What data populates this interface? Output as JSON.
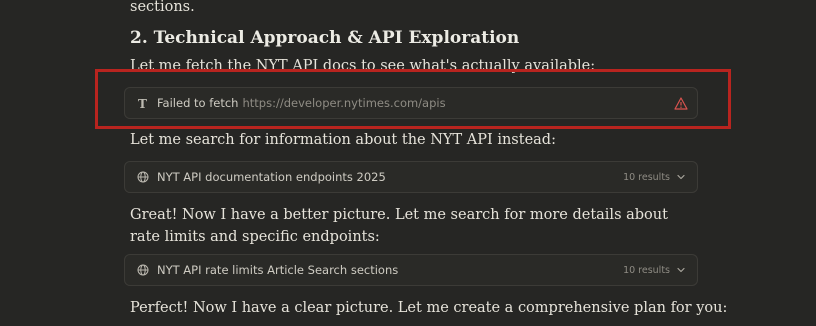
{
  "content": {
    "top_fragment": "sections.",
    "heading": "2. Technical Approach & API Exploration",
    "intro": "Let me fetch the NYT API docs to see what's actually available:",
    "fetch_card": {
      "status": "Failed to fetch",
      "url": "https://developer.nytimes.com/apis",
      "icon": "nyt-favicon",
      "status_icon": "warning-triangle-icon",
      "status_color": "#d9534f"
    },
    "search_intro": "Let me search for information about the NYT API instead:",
    "search1": {
      "query": "NYT API documentation endpoints 2025",
      "count": "10 results",
      "icon": "globe-icon"
    },
    "followup": "Great! Now I have a better picture. Let me search for more details about rate limits and specific endpoints:",
    "search2": {
      "query": "NYT API rate limits Article Search sections",
      "count": "10 results",
      "icon": "globe-icon"
    },
    "closing": "Perfect! Now I have a clear picture. Let me create a comprehensive plan for you:"
  },
  "colors": {
    "background": "#262624",
    "highlight": "#b8241f"
  }
}
